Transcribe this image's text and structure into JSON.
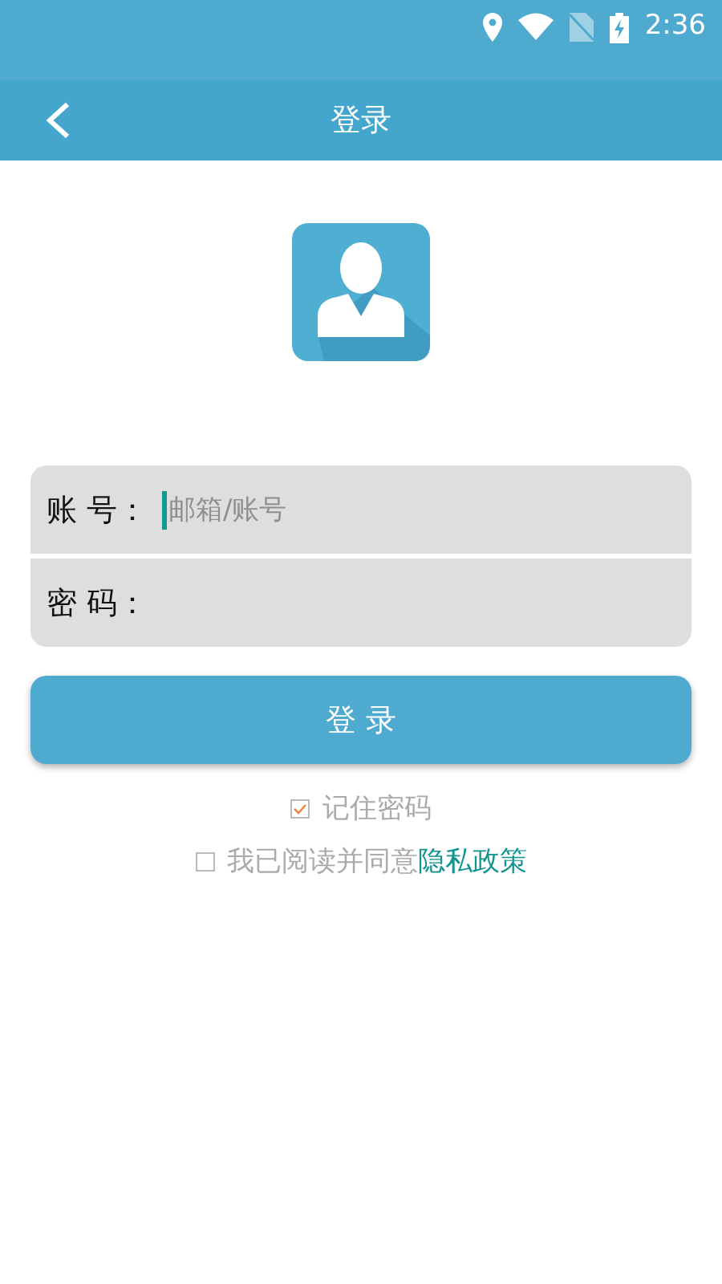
{
  "status_bar": {
    "time": "2:36"
  },
  "app_bar": {
    "title": "登录"
  },
  "form": {
    "fields": [
      {
        "label": "账 号：",
        "placeholder": "邮箱/账号",
        "focused": true
      },
      {
        "label": "密 码：",
        "focused": false
      }
    ]
  },
  "login_button": "登 录",
  "options": [
    {
      "kind": "checkbox",
      "label": "记住密码",
      "checked": true
    },
    {
      "kind": "checkbox",
      "label": "我已阅读并同意",
      "link": "隐私政策",
      "checked": false
    }
  ]
}
